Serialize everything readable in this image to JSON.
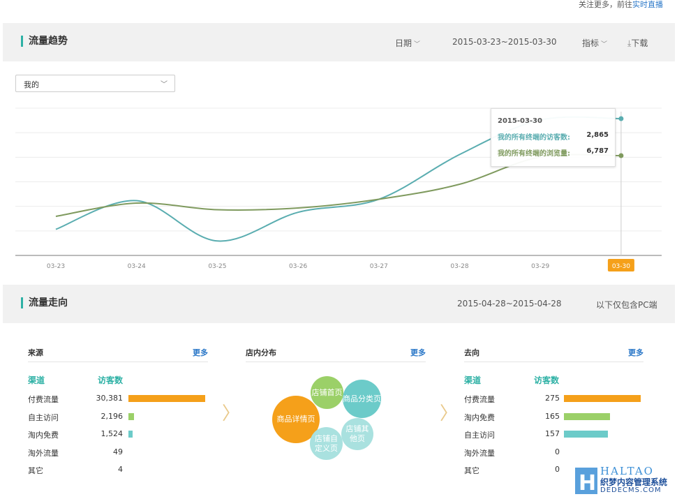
{
  "topbar": {
    "prefix": "关注更多，前往",
    "link": "实时直播"
  },
  "trend": {
    "title": "流量趋势",
    "date_label": "日期",
    "date_range": "2015-03-23~2015-03-30",
    "metric_label": "指标",
    "download_label": "下载",
    "select_value": "我的"
  },
  "chart_data": {
    "type": "line",
    "x": [
      "03-23",
      "03-24",
      "03-25",
      "03-26",
      "03-27",
      "03-28",
      "03-29",
      "03-30"
    ],
    "highlighted_x": "03-30",
    "series": [
      {
        "name": "我的所有终端的访客数",
        "color": "#5aadb0",
        "values": [
          380,
          1020,
          120,
          760,
          1050,
          2050,
          2820,
          2865
        ]
      },
      {
        "name": "我的所有终端的浏览量",
        "color": "#7f9a5e",
        "values": [
          860,
          1240,
          1050,
          1100,
          1350,
          1780,
          2560,
          6787
        ]
      }
    ],
    "tooltip": {
      "date": "2015-03-30",
      "rows": [
        {
          "label": "我的所有终端的访客数:",
          "value": "2,865",
          "color": "#5aadb0"
        },
        {
          "label": "我的所有终端的浏览量:",
          "value": "6,787",
          "color": "#7f9a5e"
        }
      ]
    },
    "grid": true
  },
  "flow": {
    "title": "流量走向",
    "date_range": "2015-04-28~2015-04-28",
    "note": "以下仅包含PC端",
    "source": {
      "title": "来源",
      "more": "更多",
      "col1": "渠道",
      "col2": "访客数",
      "rows": [
        {
          "name": "付费流量",
          "value": "30,381",
          "fraction": 1.0,
          "color": "#f5a01a"
        },
        {
          "name": "自主访问",
          "value": "2,196",
          "fraction": 0.07,
          "color": "#9bd068"
        },
        {
          "name": "淘内免费",
          "value": "1,524",
          "fraction": 0.05,
          "color": "#6ccbc9"
        },
        {
          "name": "淘外流量",
          "value": "49",
          "fraction": 0,
          "color": "#ccc"
        },
        {
          "name": "其它",
          "value": "4",
          "fraction": 0,
          "color": "#ccc"
        }
      ]
    },
    "distribution": {
      "title": "店内分布",
      "more": "更多",
      "bubbles": [
        {
          "label": "商品详情页",
          "color": "#f5a01a"
        },
        {
          "label": "店铺首页",
          "color": "#9bd068"
        },
        {
          "label": "商品分类页",
          "color": "#6ccbc9"
        },
        {
          "label": "店铺其他页",
          "color": "#a9e1df"
        },
        {
          "label": "店铺自定义页",
          "color": "#a9e1df"
        }
      ]
    },
    "dest": {
      "title": "去向",
      "more": "更多",
      "col1": "渠道",
      "col2": "访客数",
      "rows": [
        {
          "name": "付费流量",
          "value": "275",
          "fraction": 1.0,
          "color": "#f5a01a"
        },
        {
          "name": "淘内免费",
          "value": "165",
          "fraction": 0.6,
          "color": "#9bd068"
        },
        {
          "name": "自主访问",
          "value": "157",
          "fraction": 0.57,
          "color": "#6ccbc9"
        },
        {
          "name": "淘外流量",
          "value": "0",
          "fraction": 0,
          "color": "#ccc"
        },
        {
          "name": "其它",
          "value": "0",
          "fraction": 0,
          "color": "#ccc"
        }
      ]
    }
  },
  "watermark": {
    "brand": "HALTAO",
    "cn": "织梦内容管理系统",
    "url": "DEDECMS.COM"
  }
}
